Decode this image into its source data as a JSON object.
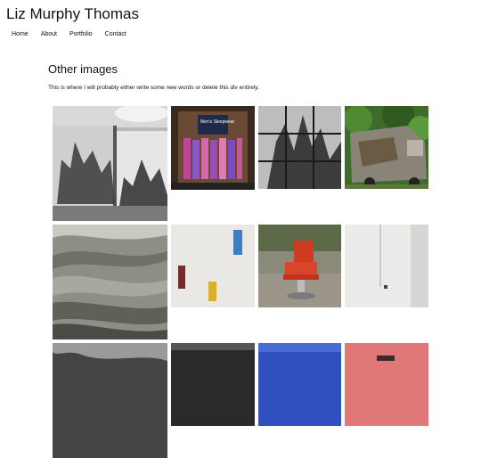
{
  "site": {
    "title": "Liz Murphy Thomas"
  },
  "nav": {
    "items": [
      "Home",
      "About",
      "Portfolio",
      "Contact"
    ]
  },
  "section": {
    "heading": "Other images",
    "description": "This is where I will probably either write some new words or delete this div entirely."
  },
  "gallery": {
    "images": [
      {
        "subject": "tree shadows on white garage wall"
      },
      {
        "subject": "shop window display",
        "sign": "Men's Sleepwear"
      },
      {
        "subject": "palm shadows through window grid"
      },
      {
        "subject": "rusted van among foliage"
      },
      {
        "subject": "layered sediment abstract"
      },
      {
        "subject": "stucco wall with colored windows"
      },
      {
        "subject": "red barber chair outdoors"
      },
      {
        "subject": "pale column and wall"
      },
      {
        "subject": "trees, partially visible"
      },
      {
        "subject": "dark foliage, partially visible"
      },
      {
        "subject": "blue sky, partially visible"
      },
      {
        "subject": "pink wall, partially visible"
      }
    ]
  }
}
